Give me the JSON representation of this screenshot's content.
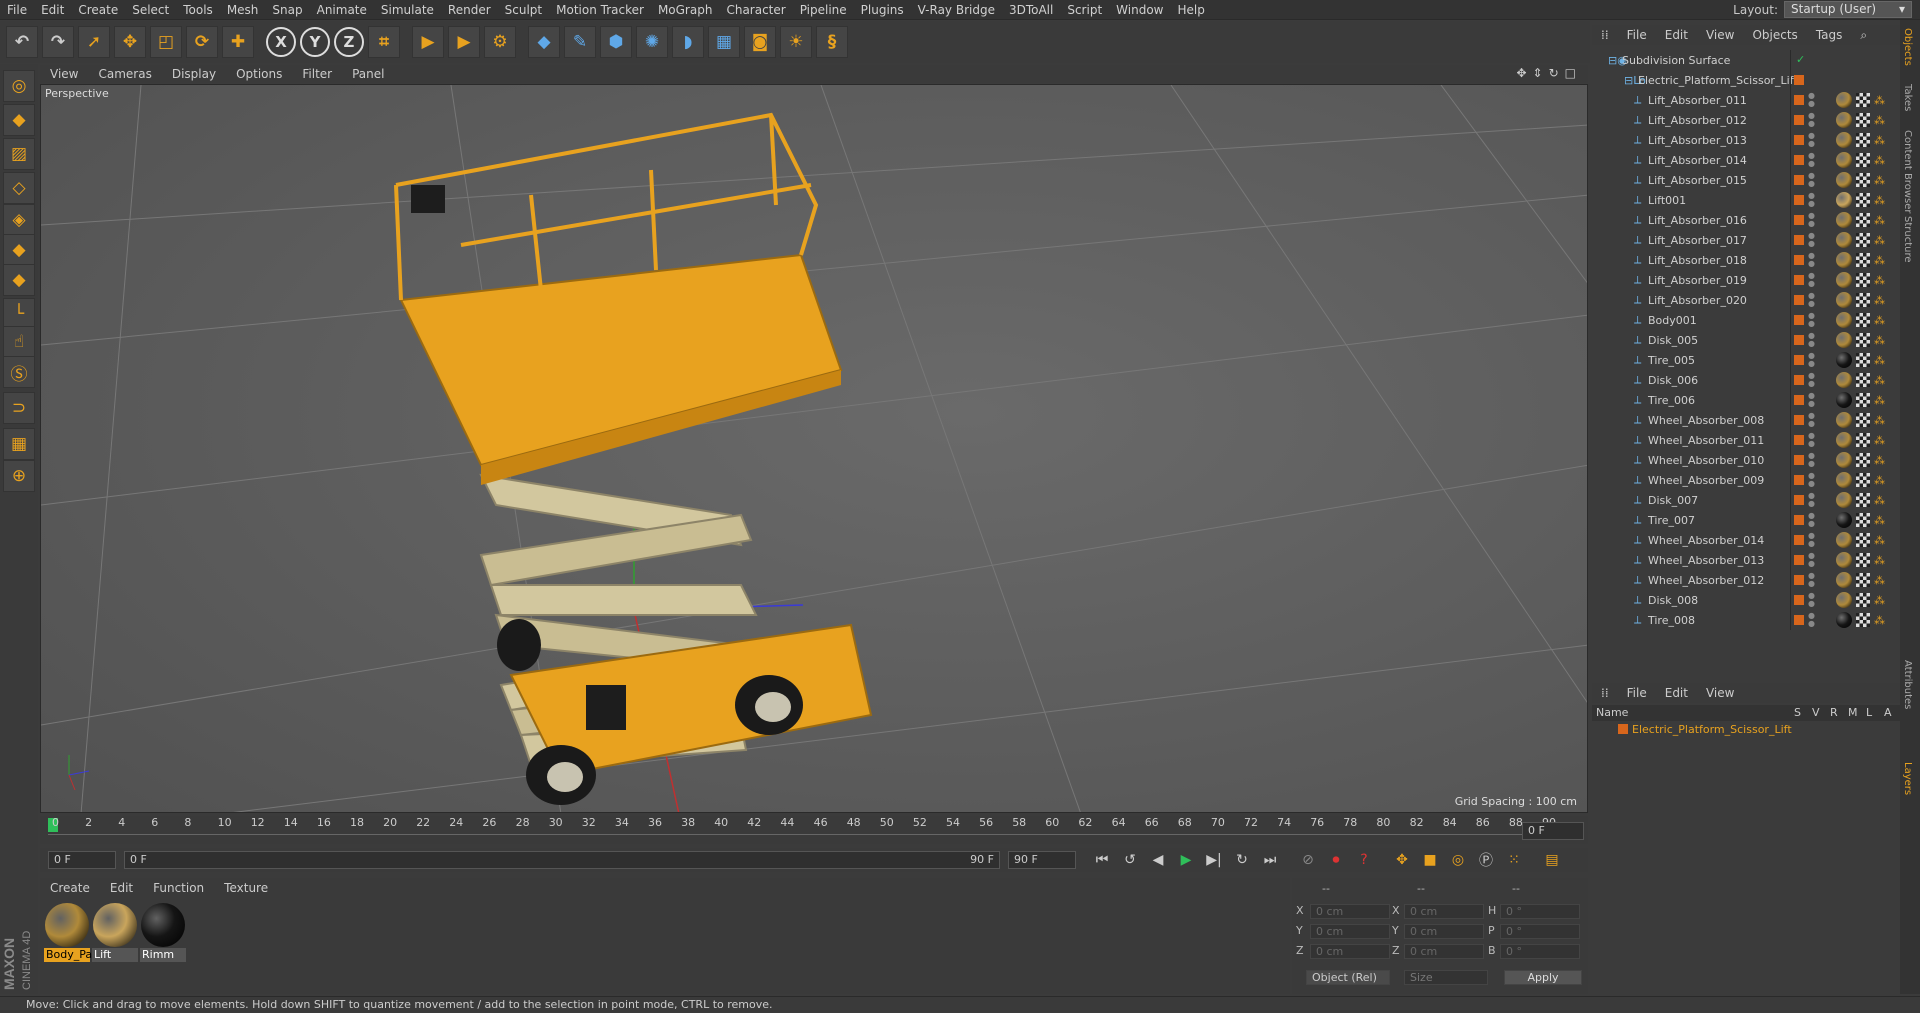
{
  "menubar": {
    "items": [
      "File",
      "Edit",
      "Create",
      "Select",
      "Tools",
      "Mesh",
      "Snap",
      "Animate",
      "Simulate",
      "Render",
      "Sculpt",
      "Motion Tracker",
      "MoGraph",
      "Character",
      "Pipeline",
      "Plugins",
      "V-Ray Bridge",
      "3DToAll",
      "Script",
      "Window",
      "Help"
    ],
    "layout_label": "Layout:",
    "layout_value": "Startup (User)"
  },
  "toolbar": {
    "tools": [
      "undo-icon",
      "redo-icon",
      "select-icon",
      "move-icon",
      "scale-icon",
      "rotate-icon",
      "add-icon",
      "x-axis-icon",
      "y-axis-icon",
      "z-axis-icon",
      "coord-system-icon",
      "render-view-icon",
      "render-picture-viewer-icon",
      "render-settings-icon",
      "cube-icon",
      "pen-icon",
      "subdivide-icon",
      "array-icon",
      "deformer-icon",
      "floor-icon",
      "camera-icon",
      "light-icon",
      "python-icon"
    ],
    "axis_labels": [
      "X",
      "Y",
      "Z"
    ]
  },
  "viewport": {
    "menu": [
      "View",
      "Cameras",
      "Display",
      "Options",
      "Filter",
      "Panel"
    ],
    "label": "Perspective",
    "grid_spacing": "Grid Spacing : 100 cm"
  },
  "timeline": {
    "ticks": [
      "0",
      "2",
      "4",
      "6",
      "8",
      "10",
      "12",
      "14",
      "16",
      "18",
      "20",
      "22",
      "24",
      "26",
      "28",
      "30",
      "32",
      "34",
      "36",
      "38",
      "40",
      "42",
      "44",
      "46",
      "48",
      "50",
      "52",
      "54",
      "56",
      "58",
      "60",
      "62",
      "64",
      "66",
      "68",
      "70",
      "72",
      "74",
      "76",
      "78",
      "80",
      "82",
      "84",
      "86",
      "88",
      "90"
    ],
    "current_frame": "0 F",
    "start_field": "0 F",
    "range_start": "0 F",
    "range_end": "90 F",
    "end_field": "90 F"
  },
  "materials": {
    "menu": [
      "Create",
      "Edit",
      "Function",
      "Texture"
    ],
    "items": [
      {
        "label": "Body_Pa",
        "color": "#b08a3a",
        "selected": true
      },
      {
        "label": "Lift",
        "color": "#c9a55c",
        "selected": false
      },
      {
        "label": "Rimm",
        "color": "#151515",
        "selected": false
      }
    ]
  },
  "coords": {
    "headers": [
      "--",
      "--",
      "--"
    ],
    "rows": [
      {
        "a": "X",
        "av": "0 cm",
        "b": "X",
        "bv": "0 cm",
        "c": "H",
        "cv": "0 °"
      },
      {
        "a": "Y",
        "av": "0 cm",
        "b": "Y",
        "bv": "0 cm",
        "c": "P",
        "cv": "0 °"
      },
      {
        "a": "Z",
        "av": "0 cm",
        "b": "Z",
        "bv": "0 cm",
        "c": "B",
        "cv": "0 °"
      }
    ],
    "mode": "Object (Rel)",
    "size": "Size",
    "apply": "Apply"
  },
  "object_manager": {
    "menu": [
      "File",
      "Edit",
      "View",
      "Objects",
      "Tags"
    ],
    "root": "Subdivision Surface",
    "group": "Electric_Platform_Scissor_Lift",
    "items": [
      {
        "name": "Lift_Absorber_011",
        "tex": "#b08a3a"
      },
      {
        "name": "Lift_Absorber_012",
        "tex": "#b08a3a"
      },
      {
        "name": "Lift_Absorber_013",
        "tex": "#b08a3a"
      },
      {
        "name": "Lift_Absorber_014",
        "tex": "#b08a3a"
      },
      {
        "name": "Lift_Absorber_015",
        "tex": "#b08a3a"
      },
      {
        "name": "Lift001",
        "tex": "#c9a55c"
      },
      {
        "name": "Lift_Absorber_016",
        "tex": "#b08a3a"
      },
      {
        "name": "Lift_Absorber_017",
        "tex": "#b08a3a"
      },
      {
        "name": "Lift_Absorber_018",
        "tex": "#b08a3a"
      },
      {
        "name": "Lift_Absorber_019",
        "tex": "#b08a3a"
      },
      {
        "name": "Lift_Absorber_020",
        "tex": "#b08a3a"
      },
      {
        "name": "Body001",
        "tex": "#b08a3a"
      },
      {
        "name": "Disk_005",
        "tex": "#b08a3a"
      },
      {
        "name": "Tire_005",
        "tex": "#151515"
      },
      {
        "name": "Disk_006",
        "tex": "#b08a3a"
      },
      {
        "name": "Tire_006",
        "tex": "#151515"
      },
      {
        "name": "Wheel_Absorber_008",
        "tex": "#b08a3a"
      },
      {
        "name": "Wheel_Absorber_011",
        "tex": "#b08a3a"
      },
      {
        "name": "Wheel_Absorber_010",
        "tex": "#b08a3a"
      },
      {
        "name": "Wheel_Absorber_009",
        "tex": "#b08a3a"
      },
      {
        "name": "Disk_007",
        "tex": "#b08a3a"
      },
      {
        "name": "Tire_007",
        "tex": "#151515"
      },
      {
        "name": "Wheel_Absorber_014",
        "tex": "#b08a3a"
      },
      {
        "name": "Wheel_Absorber_013",
        "tex": "#b08a3a"
      },
      {
        "name": "Wheel_Absorber_012",
        "tex": "#b08a3a"
      },
      {
        "name": "Disk_008",
        "tex": "#b08a3a"
      },
      {
        "name": "Tire_008",
        "tex": "#151515"
      }
    ]
  },
  "layer_manager": {
    "menu": [
      "File",
      "Edit",
      "View"
    ],
    "columns": [
      "Name",
      "S",
      "V",
      "R",
      "M",
      "L",
      "A"
    ],
    "layer": "Electric_Platform_Scissor_Lift"
  },
  "right_tabs": [
    "Objects",
    "Takes",
    "Content Browser",
    "Structure",
    "Attributes",
    "Layers"
  ],
  "status": "Move: Click and drag to move elements. Hold down SHIFT to quantize movement / add to the selection in point mode, CTRL to remove.",
  "colors": {
    "accent": "#e8a21f",
    "lift": "#e8a21f",
    "scissor": "#c9bd92",
    "object_icon": "#6fb3e6"
  }
}
